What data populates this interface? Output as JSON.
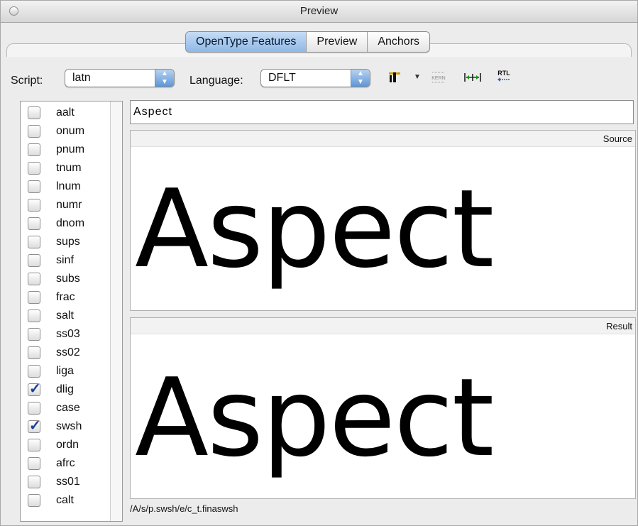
{
  "window": {
    "title": "Preview"
  },
  "tabs": [
    {
      "label": "OpenType Features",
      "active": true
    },
    {
      "label": "Preview",
      "active": false
    },
    {
      "label": "Anchors",
      "active": false
    }
  ],
  "toolbar": {
    "script_label": "Script:",
    "script_value": "latn",
    "language_label": "Language:",
    "language_value": "DFLT",
    "icons": [
      "text-size-icon",
      "dropdown-triangle-icon",
      "kern-icon",
      "spacing-icon",
      "rtl-icon"
    ],
    "kern_label": "KERN",
    "rtl_label": "RTL"
  },
  "features": [
    {
      "tag": "aalt",
      "checked": false
    },
    {
      "tag": "onum",
      "checked": false
    },
    {
      "tag": "pnum",
      "checked": false
    },
    {
      "tag": "tnum",
      "checked": false
    },
    {
      "tag": "lnum",
      "checked": false
    },
    {
      "tag": "numr",
      "checked": false
    },
    {
      "tag": "dnom",
      "checked": false
    },
    {
      "tag": "sups",
      "checked": false
    },
    {
      "tag": "sinf",
      "checked": false
    },
    {
      "tag": "subs",
      "checked": false
    },
    {
      "tag": "frac",
      "checked": false
    },
    {
      "tag": "salt",
      "checked": false
    },
    {
      "tag": "ss03",
      "checked": false
    },
    {
      "tag": "ss02",
      "checked": false
    },
    {
      "tag": "liga",
      "checked": false
    },
    {
      "tag": "dlig",
      "checked": true
    },
    {
      "tag": "case",
      "checked": false
    },
    {
      "tag": "swsh",
      "checked": true
    },
    {
      "tag": "ordn",
      "checked": false
    },
    {
      "tag": "afrc",
      "checked": false
    },
    {
      "tag": "ss01",
      "checked": false
    },
    {
      "tag": "calt",
      "checked": false
    }
  ],
  "input_text": "Aspect",
  "source": {
    "label": "Source",
    "glyphs": "Aspect"
  },
  "result": {
    "label": "Result",
    "glyphs": "Aspect"
  },
  "glyph_path": "/A/s/p.swsh/e/c_t.finaswsh"
}
